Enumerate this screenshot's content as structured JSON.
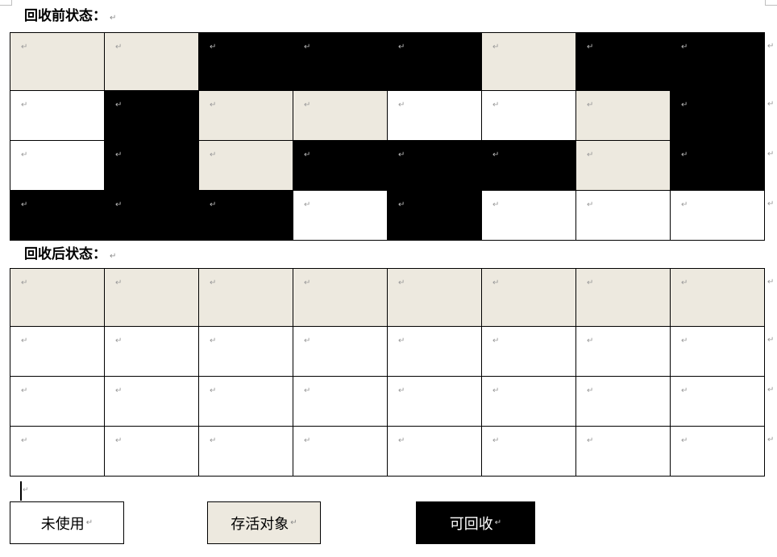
{
  "paragraph_mark": "↵",
  "colors": {
    "unused": "#ffffff",
    "live": "#ede9df",
    "reclaimable": "#000000"
  },
  "before": {
    "title": "回收前状态：",
    "rows": [
      [
        "l",
        "l",
        "r",
        "r",
        "r",
        "l",
        "r",
        "r"
      ],
      [
        "u",
        "r",
        "l",
        "l",
        "u",
        "u",
        "l",
        "r"
      ],
      [
        "u",
        "r",
        "l",
        "r",
        "r",
        "r",
        "l",
        "r"
      ],
      [
        "r",
        "r",
        "r",
        "u",
        "r",
        "u",
        "u",
        "u"
      ]
    ]
  },
  "after": {
    "title": "回收后状态：",
    "rows": [
      [
        "l",
        "l",
        "l",
        "l",
        "l",
        "l",
        "l",
        "l"
      ],
      [
        "u",
        "u",
        "u",
        "u",
        "u",
        "u",
        "u",
        "u"
      ],
      [
        "u",
        "u",
        "u",
        "u",
        "u",
        "u",
        "u",
        "u"
      ],
      [
        "u",
        "u",
        "u",
        "u",
        "u",
        "u",
        "u",
        "u"
      ]
    ]
  },
  "legend": {
    "unused": "未使用",
    "live": "存活对象",
    "reclaimable": "可回收"
  }
}
